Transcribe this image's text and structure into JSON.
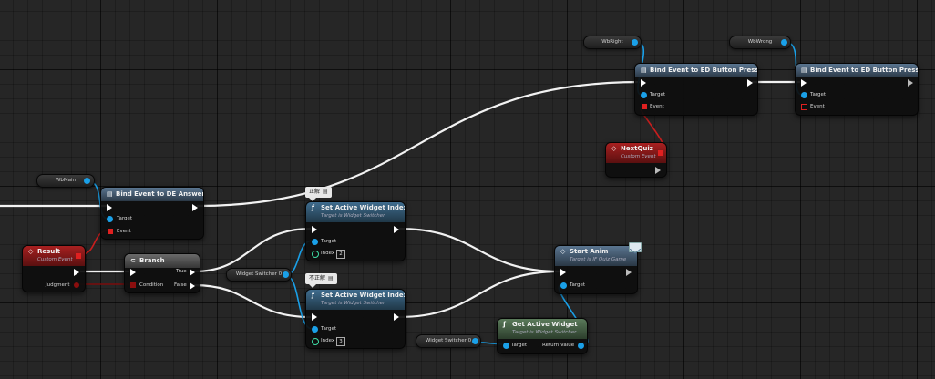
{
  "graph": {
    "variables": {
      "wbmain": "WbMain",
      "wbright": "WbRight",
      "wbwrong": "WbWrong",
      "widget_switcher_a": "Widget Switcher 0",
      "widget_switcher_b": "Widget Switcher 0"
    },
    "bind_de": {
      "title": "Bind Event to DE Answer",
      "target": "Target",
      "event": "Event"
    },
    "bind_ed_1": {
      "title": "Bind Event to ED Button Pressed",
      "target": "Target",
      "event": "Event"
    },
    "bind_ed_2": {
      "title": "Bind Event to ED Button Pressed",
      "target": "Target",
      "event": "Event"
    },
    "nextquiz": {
      "title": "NextQuiz",
      "subtitle": "Custom Event"
    },
    "result": {
      "title": "Result",
      "subtitle": "Custom Event",
      "judgment": "Judgment"
    },
    "branch": {
      "title": "Branch",
      "condition": "Condition",
      "true_label": "True",
      "false_label": "False"
    },
    "set_index_1": {
      "title": "Set Active Widget Index",
      "subtitle": "Target is Widget Switcher",
      "target": "Target",
      "index": "Index",
      "index_value": "2"
    },
    "set_index_2": {
      "title": "Set Active Widget Index",
      "subtitle": "Target is Widget Switcher",
      "target": "Target",
      "index": "Index",
      "index_value": "3"
    },
    "start_anim": {
      "title": "Start Anim",
      "subtitle": "Target is IF Quiz Game",
      "target": "Target"
    },
    "get_active": {
      "title": "Get Active Widget",
      "subtitle": "Target is Widget Switcher",
      "target": "Target",
      "return_value": "Return Value"
    },
    "comments": {
      "correct": "正解",
      "incorrect": "不正解"
    }
  },
  "colors": {
    "exec": "#ffffff",
    "object": "#1aa0e8",
    "delegate": "#e02020",
    "bool": "#8b0e0e",
    "int": "#3fe0a8"
  }
}
